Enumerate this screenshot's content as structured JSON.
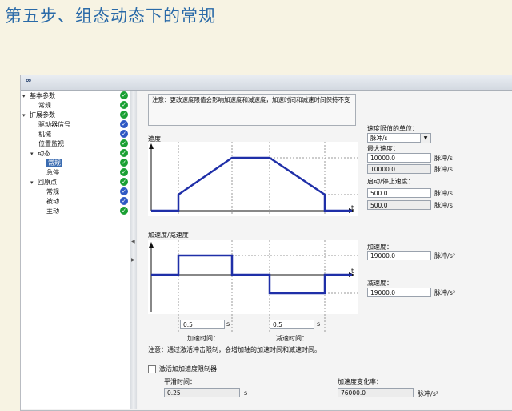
{
  "slide_title": "第五步、组态动态下的常规",
  "toolbar": {
    "icon": "link-icon"
  },
  "tree": [
    {
      "label": "基本参数",
      "toggle": "▾",
      "status": "green"
    },
    {
      "label": "常规",
      "toggle": "",
      "status": "green"
    },
    {
      "label": "扩展参数",
      "toggle": "▾",
      "status": "green"
    },
    {
      "label": "驱动器信号",
      "toggle": "",
      "status": "blue"
    },
    {
      "label": "机械",
      "toggle": "",
      "status": "blue"
    },
    {
      "label": "位置监视",
      "toggle": "",
      "status": "green"
    },
    {
      "label": "动态",
      "toggle": "▾",
      "status": "green"
    },
    {
      "label": "常规",
      "toggle": "",
      "status": "green"
    },
    {
      "label": "急停",
      "toggle": "",
      "status": "green"
    },
    {
      "label": "回原点",
      "toggle": "▾",
      "status": "green"
    },
    {
      "label": "常规",
      "toggle": "",
      "status": "blue"
    },
    {
      "label": "被动",
      "toggle": "",
      "status": "blue"
    },
    {
      "label": "主动",
      "toggle": "",
      "status": "green"
    }
  ],
  "note_top": "注意：更改速度限值会影响加速度和减速度，加速时间和减速时间保持不变",
  "speed_chart": {
    "ylabel": "速度",
    "xlabel": "t"
  },
  "accel_chart": {
    "ylabel": "加速度/减速度",
    "xlabel": "t"
  },
  "fields": {
    "speed_unit_label": "速度限值的单位：",
    "speed_unit_value": "脉冲/s",
    "max_speed_label": "最大速度：",
    "max_speed_value": "10000.0",
    "max_speed_value2": "10000.0",
    "startstop_label": "启动/停止速度：",
    "startstop_value": "500.0",
    "startstop_value2": "500.0",
    "unit_speed": "脉冲/s",
    "accel_label": "加速度：",
    "accel_value": "19000.0",
    "decel_label": "减速度：",
    "decel_value": "19000.0",
    "unit_accel": "脉冲/s²",
    "accel_time_value": "0.5",
    "accel_time_unit": "s",
    "accel_time_label": "加速时间：",
    "decel_time_value": "0.5",
    "decel_time_unit": "s",
    "decel_time_label": "减速时间：",
    "note_bottom": "注意：通过激活冲击限制，会增加轴的加速时间和减速时间。",
    "jerk_checkbox_label": "激活加加速度限制器",
    "smooth_time_label": "平滑时间：",
    "smooth_time_value": "0.25",
    "smooth_time_unit": "s",
    "jerk_label": "加速度变化率：",
    "jerk_value": "76000.0",
    "jerk_unit": "脉冲/s³"
  },
  "colors": {
    "curve": "#1f2fa8",
    "check_green": "#1aa033",
    "check_blue": "#2f59c4"
  }
}
